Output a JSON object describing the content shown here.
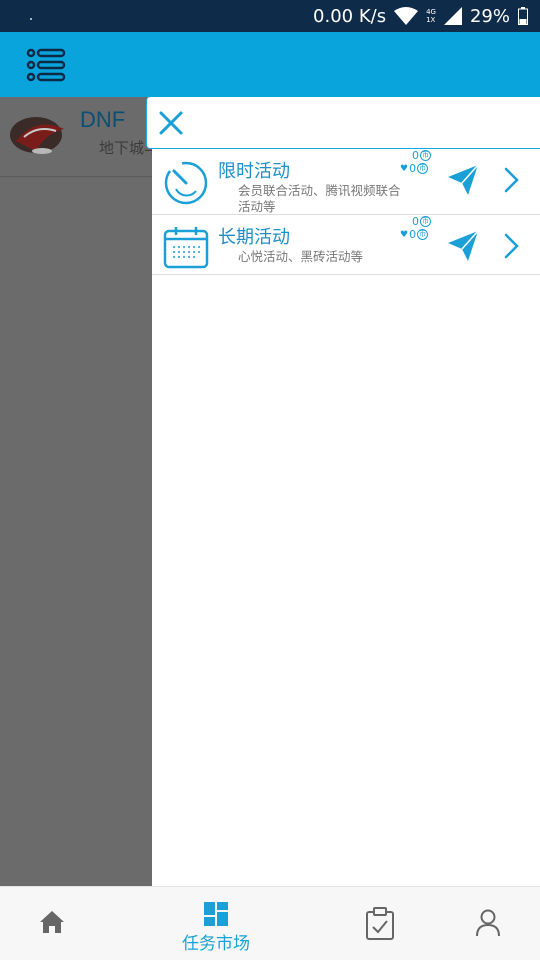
{
  "status_bar": {
    "net_speed": "0.00 K/s",
    "network_badge_top": "4G",
    "network_badge_bottom": "1X",
    "battery": "29%"
  },
  "background_list": {
    "items": [
      {
        "title": "DNF",
        "subtitle": "地下城与勇士"
      }
    ]
  },
  "drawer": {
    "tasks": [
      {
        "title": "限时活动",
        "description": "会员联合活动、腾讯视频联合活动等",
        "coin_count": "0",
        "heart_count": "0",
        "icon": "stopwatch-icon"
      },
      {
        "title": "长期活动",
        "description": "心悦活动、黑砖活动等",
        "coin_count": "0",
        "heart_count": "0",
        "icon": "calendar-icon"
      }
    ],
    "coin_symbol": "币"
  },
  "bottom_nav": {
    "items": [
      {
        "name": "home",
        "label": ""
      },
      {
        "name": "market",
        "label": "任务市场"
      },
      {
        "name": "tasks",
        "label": ""
      },
      {
        "name": "profile",
        "label": ""
      }
    ]
  },
  "colors": {
    "accent": "#0aa4dc",
    "status_bar": "#0f2b4a",
    "overlay": "#6b6b6b"
  }
}
